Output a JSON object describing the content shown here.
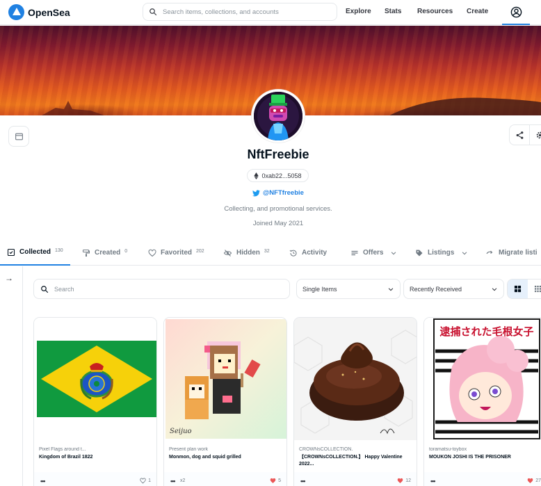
{
  "header": {
    "logo_text": "OpenSea",
    "search_placeholder": "Search items, collections, and accounts",
    "nav": [
      "Explore",
      "Stats",
      "Resources",
      "Create"
    ]
  },
  "profile": {
    "name": "NftFreebie",
    "address": "0xab22...5058",
    "twitter": "@NFTfreebie",
    "bio": "Collecting, and promotional services.",
    "joined": "Joined May 2021"
  },
  "tabs": [
    {
      "label": "Collected",
      "count": "130"
    },
    {
      "label": "Created",
      "count": "0"
    },
    {
      "label": "Favorited",
      "count": "202"
    },
    {
      "label": "Hidden",
      "count": "32"
    },
    {
      "label": "Activity",
      "count": ""
    },
    {
      "label": "Offers",
      "count": ""
    },
    {
      "label": "Listings",
      "count": ""
    },
    {
      "label": "Migrate listi",
      "count": ""
    }
  ],
  "filters": {
    "search_placeholder": "Search",
    "items_select": "Single Items",
    "sort_select": "Recently Received"
  },
  "cards": [
    {
      "collection": "Pixel Flags around t...",
      "name": "Kingdom of Brazil 1822",
      "qty": "",
      "likes": "1",
      "liked": false
    },
    {
      "collection": "Present plan work",
      "name": "Monmon, dog and squid grilled",
      "qty": "x2",
      "likes": "5",
      "liked": true
    },
    {
      "collection": "CROWNsCOLLECTION.",
      "name": "【CROWNsCOLLECTION.】 Happy Valentine 2022...",
      "qty": "",
      "likes": "12",
      "liked": true
    },
    {
      "collection": "toramatsu-toybox",
      "name": "MOUKON JOSHI IS THE PRISONER",
      "qty": "",
      "likes": "27",
      "liked": true
    }
  ],
  "card_art": {
    "signature": "Seijuo",
    "poster_title": "逮捕された毛根女子"
  },
  "colors": {
    "accent": "#2081e2",
    "heart": "#eb5757",
    "flag_green": "#109a3f",
    "flag_yellow": "#f6d10a"
  }
}
